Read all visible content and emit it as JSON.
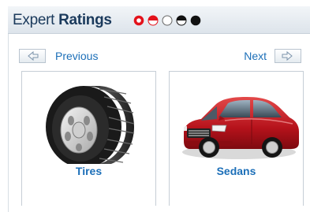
{
  "header": {
    "title_regular": "Expert",
    "title_bold": "Ratings",
    "rating_legend": [
      "full-red",
      "half-red",
      "empty",
      "half-black",
      "full-black"
    ],
    "colors": {
      "red": "#e3121b",
      "black": "#111111",
      "title": "#1b3a5c"
    }
  },
  "nav": {
    "previous_label": "Previous",
    "next_label": "Next",
    "previous_icon": "arrow-left-icon",
    "next_icon": "arrow-right-icon",
    "link_color": "#1c6fb8"
  },
  "categories": [
    {
      "label": "Tires",
      "image": "tire-image"
    },
    {
      "label": "Sedans",
      "image": "sedan-car-image"
    }
  ]
}
